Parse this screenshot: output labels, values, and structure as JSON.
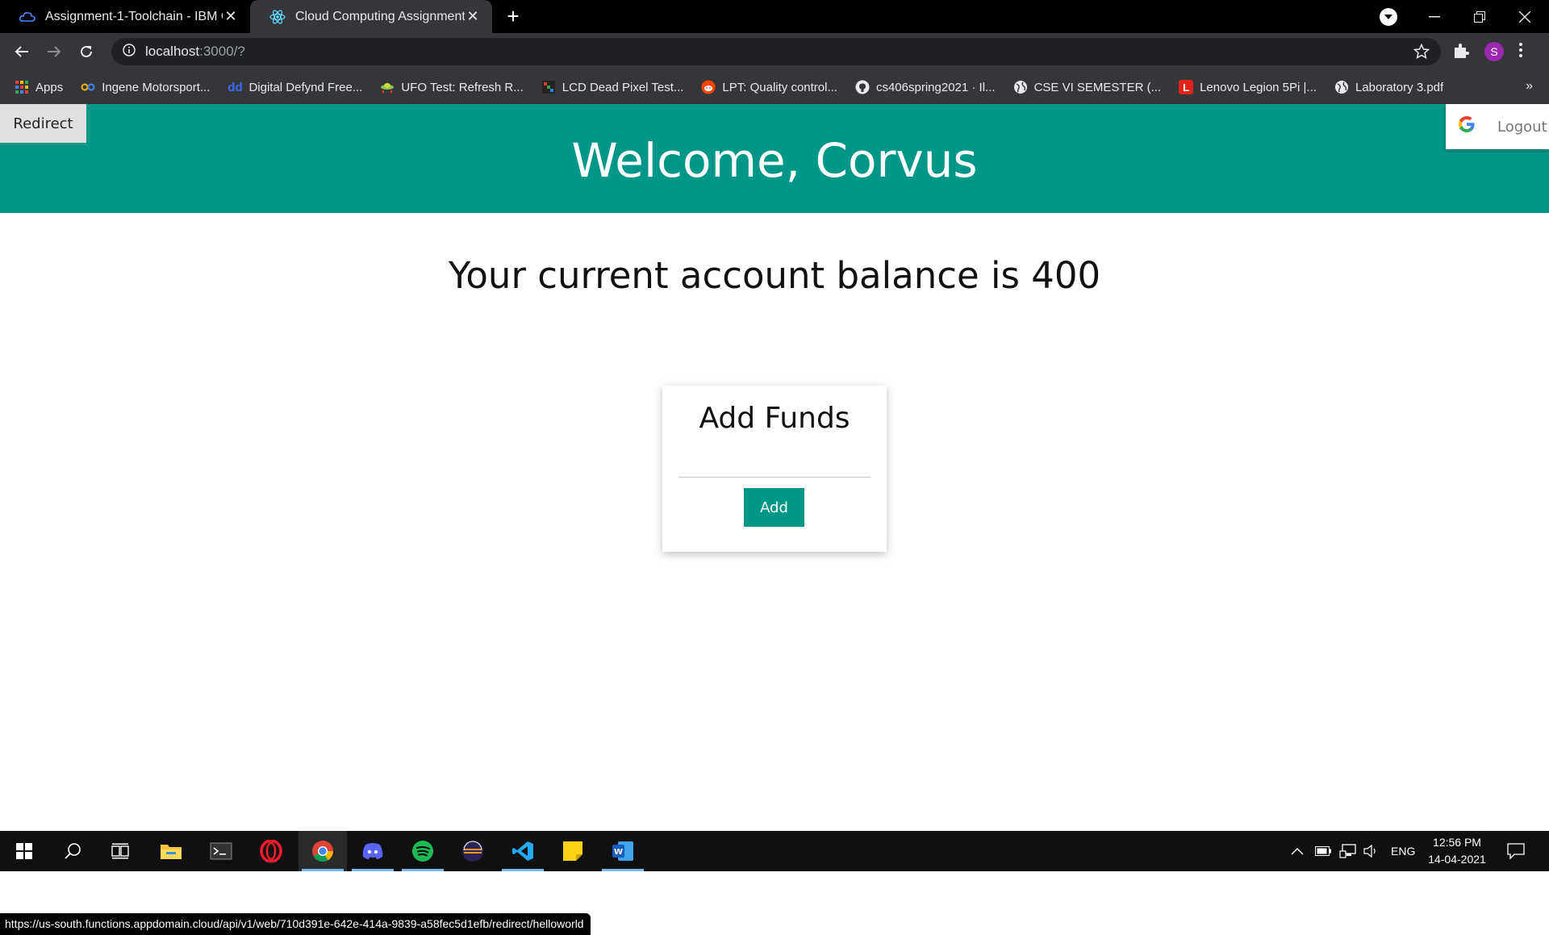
{
  "browser": {
    "tabs": [
      {
        "title": "Assignment-1-Toolchain - IBM Cl",
        "active": false,
        "favicon": "ibm-cloud-icon"
      },
      {
        "title": "Cloud Computing Assignment",
        "active": true,
        "favicon": "react-icon"
      }
    ],
    "new_tab_label": "+",
    "url_host": "localhost",
    "url_rest": ":3000/?",
    "profile_initial": "S",
    "bookmarks": [
      {
        "label": "Apps",
        "icon": "apps-grid-icon"
      },
      {
        "label": "Ingene Motorsport...",
        "icon": "ingene-icon"
      },
      {
        "label": "Digital Defynd Free...",
        "icon": "dd-icon"
      },
      {
        "label": "UFO Test: Refresh R...",
        "icon": "ufo-icon"
      },
      {
        "label": "LCD Dead Pixel Test...",
        "icon": "lcd-icon"
      },
      {
        "label": "LPT: Quality control...",
        "icon": "reddit-icon"
      },
      {
        "label": "cs406spring2021 · Il...",
        "icon": "github-icon"
      },
      {
        "label": "CSE VI SEMESTER (...",
        "icon": "globe-icon"
      },
      {
        "label": "Lenovo Legion 5Pi |...",
        "icon": "lenovo-icon"
      },
      {
        "label": "Laboratory 3.pdf",
        "icon": "globe-icon"
      }
    ],
    "more_bookmarks": "»",
    "status_url": "https://us-south.functions.appdomain.cloud/api/v1/web/710d391e-642e-414a-9839-a58fec5d1efb/redirect/helloworld"
  },
  "app": {
    "redirect_label": "Redirect",
    "logout_label": "Logout",
    "welcome": "Welcome, Corvus",
    "balance_text": "Your current account balance is 400",
    "card": {
      "title": "Add Funds",
      "amount_value": "",
      "button_label": "Add"
    },
    "colors": {
      "primary": "#009688",
      "redirect_bg": "#e0e0e0"
    }
  },
  "taskbar": {
    "apps": [
      "windows-start-icon",
      "search-icon",
      "task-view-icon",
      "file-explorer-icon",
      "terminal-icon",
      "opera-icon",
      "chrome-icon",
      "discord-icon",
      "spotify-icon",
      "eclipse-icon",
      "vscode-icon",
      "sticky-notes-icon",
      "word-icon"
    ],
    "language": "ENG",
    "time": "12:56 PM",
    "date": "14-04-2021"
  }
}
